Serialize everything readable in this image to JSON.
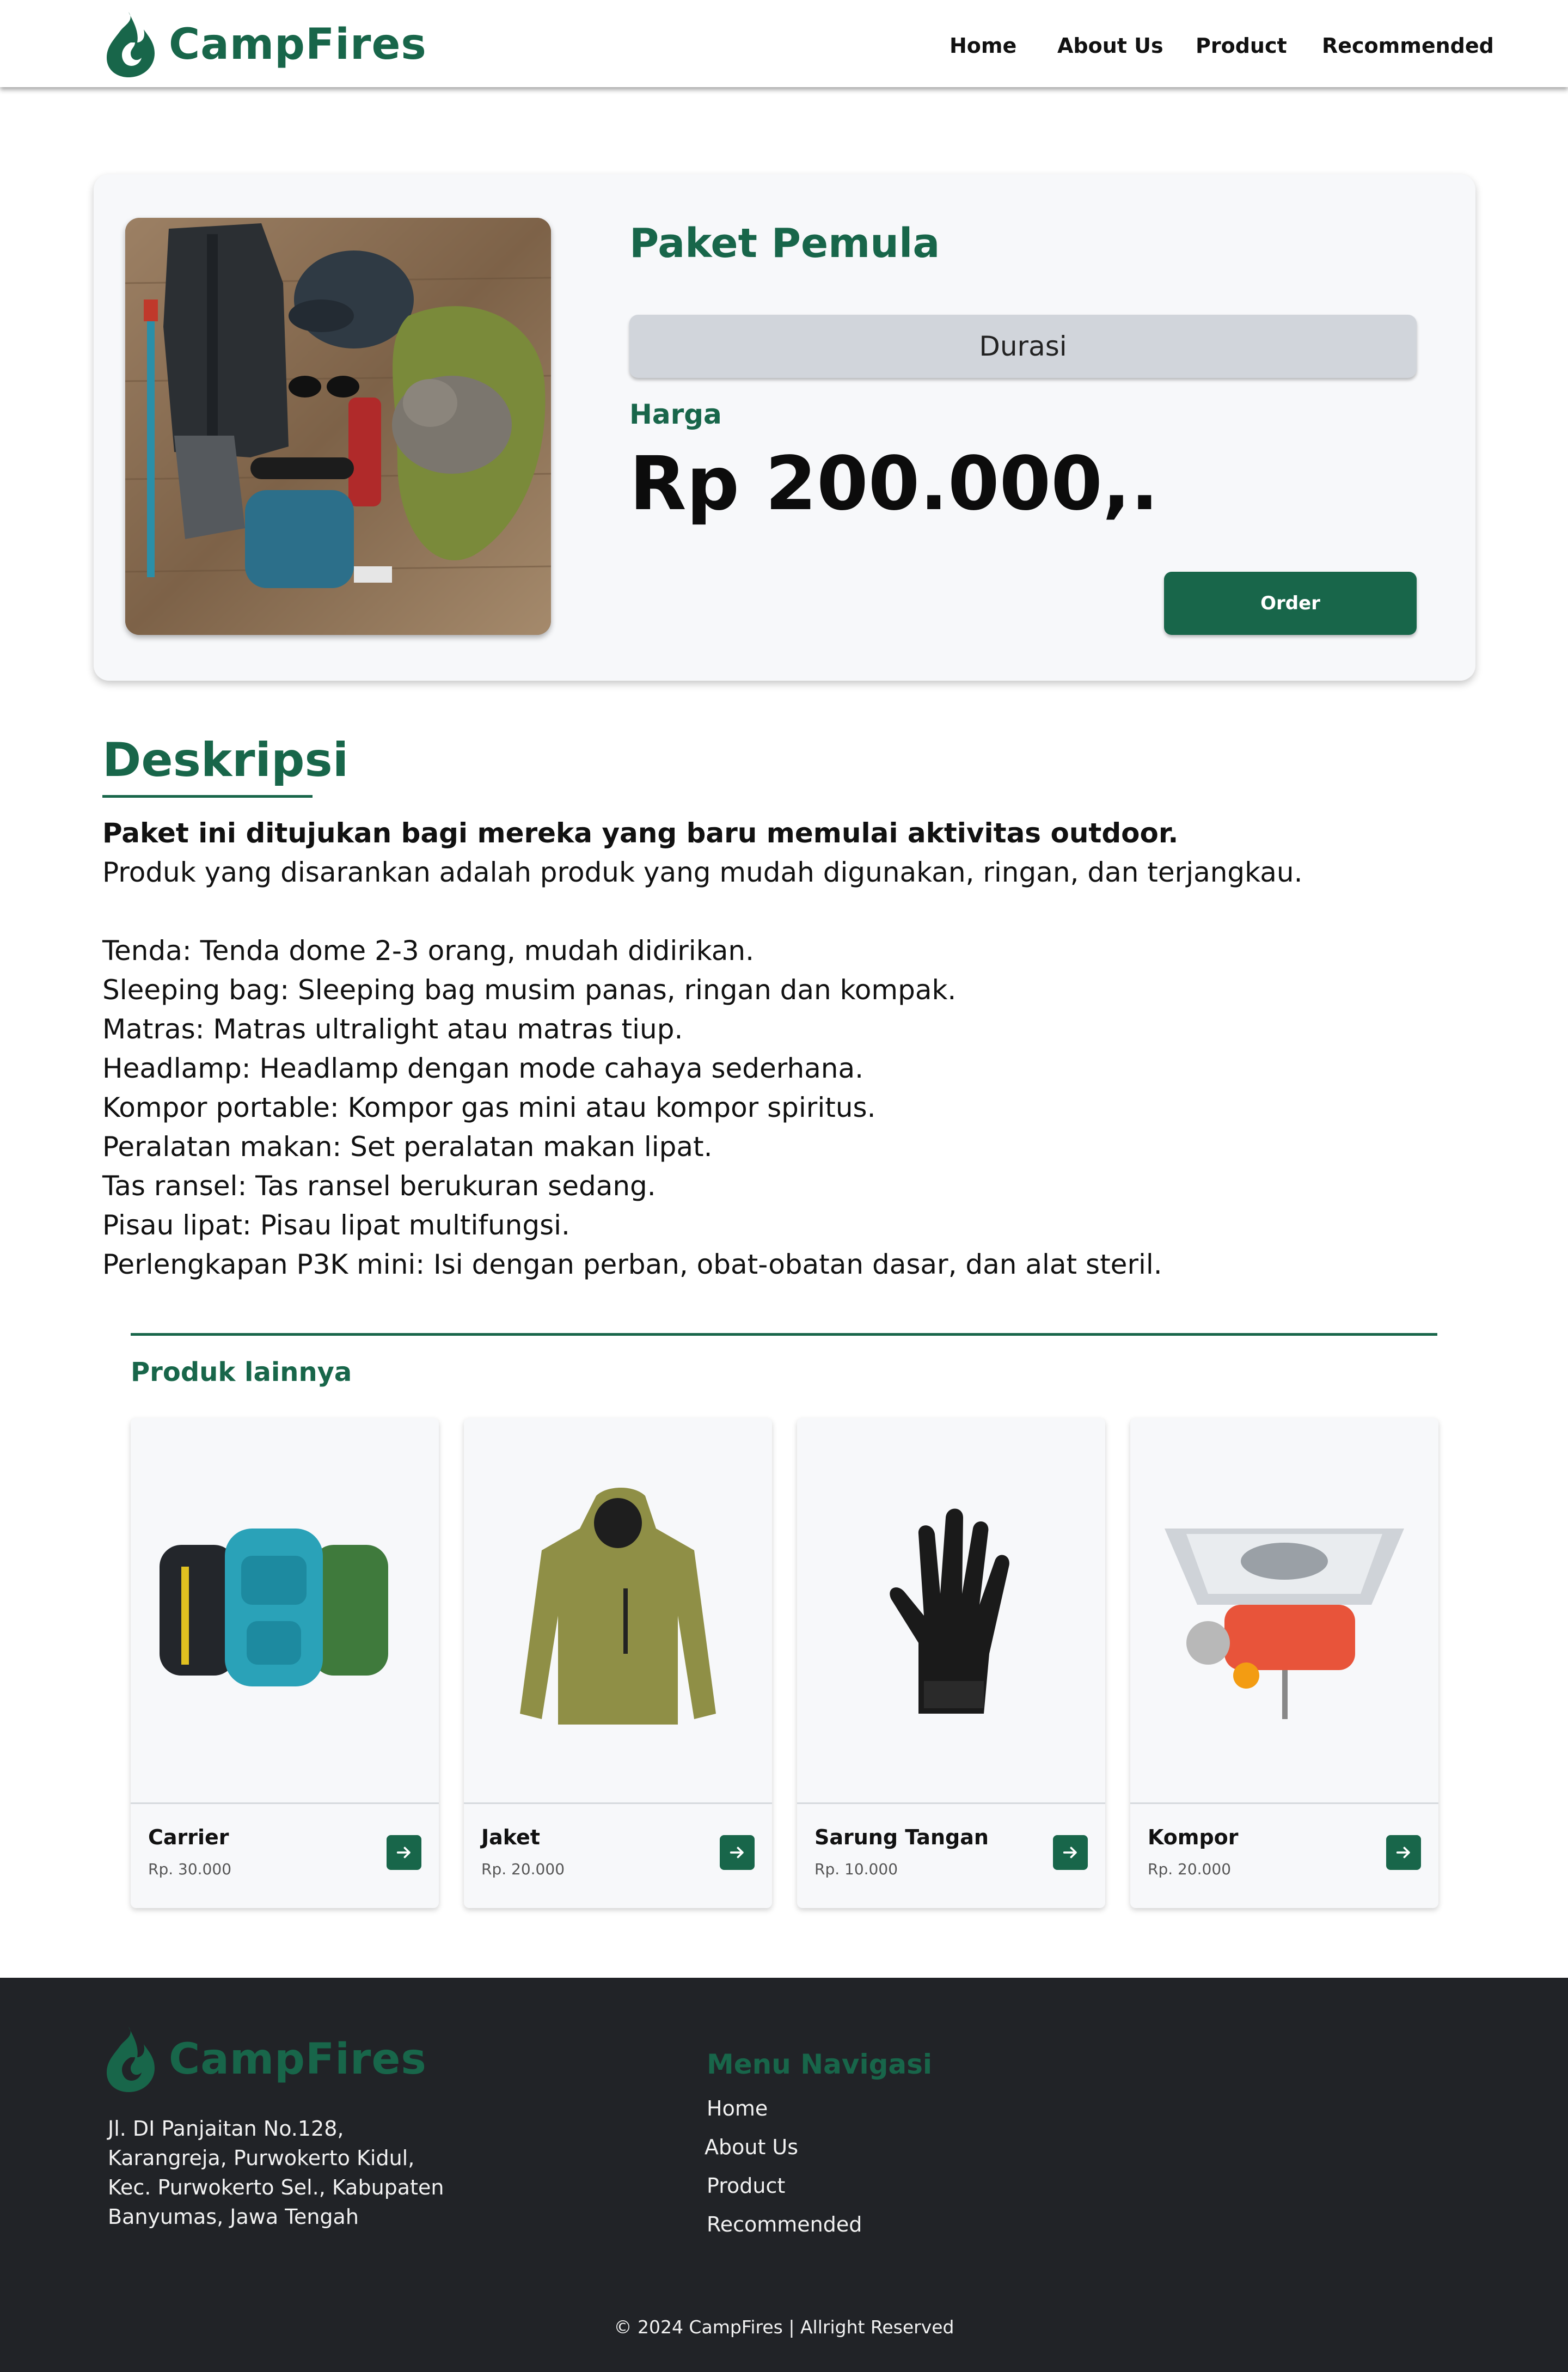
{
  "brand": {
    "name": "CampFires",
    "color": "#18664a",
    "icon": "flame-logo-icon"
  },
  "nav": [
    {
      "label": "Home"
    },
    {
      "label": "About Us"
    },
    {
      "label": "Product"
    },
    {
      "label": "Recommended"
    }
  ],
  "product": {
    "name": "Paket Pemula",
    "image_icon": "camping-gear-flatlay-photo",
    "duration_label": "Durasi",
    "price_label": "Harga",
    "price": "Rp 200.000,.",
    "order_label": "Order"
  },
  "description": {
    "heading": "Deskripsi",
    "intro_bold": "Paket ini ditujukan bagi mereka yang baru memulai aktivitas outdoor.",
    "intro": "Produk yang disarankan adalah produk yang mudah digunakan, ringan, dan terjangkau.",
    "items": [
      "Tenda: Tenda dome 2-3 orang, mudah didirikan.",
      "Sleeping bag: Sleeping bag musim panas, ringan dan kompak.",
      "Matras: Matras ultralight atau matras tiup.",
      "Headlamp: Headlamp dengan mode cahaya sederhana.",
      "Kompor portable: Kompor gas mini atau kompor spiritus.",
      "Peralatan makan: Set peralatan makan lipat.",
      "Tas ransel: Tas ransel berukuran sedang.",
      "Pisau lipat: Pisau lipat multifungsi.",
      "Perlengkapan P3K mini: Isi dengan perban, obat-obatan dasar, dan alat steril."
    ]
  },
  "other_products": {
    "heading": "Produk lainnya",
    "items": [
      {
        "name": "Carrier",
        "price": "Rp. 30.000",
        "icon": "backpack-icon"
      },
      {
        "name": "Jaket",
        "price": "Rp. 20.000",
        "icon": "jacket-icon"
      },
      {
        "name": "Sarung Tangan",
        "price": "Rp. 10.000",
        "icon": "glove-icon"
      },
      {
        "name": "Kompor",
        "price": "Rp. 20.000",
        "icon": "stove-icon"
      }
    ]
  },
  "footer": {
    "brand": "CampFires",
    "address": [
      "Jl. DI Panjaitan No.128,",
      "Karangreja, Purwokerto Kidul,",
      "Kec. Purwokerto Sel., Kabupaten",
      "Banyumas, Jawa Tengah"
    ],
    "menu_heading": "Menu Navigasi",
    "menu": [
      {
        "label": "Home"
      },
      {
        "label": "About Us"
      },
      {
        "label": "Product"
      },
      {
        "label": "Recommended"
      }
    ],
    "copyright": "© 2024 CampFires | Allright Reserved",
    "background": "#212327"
  }
}
